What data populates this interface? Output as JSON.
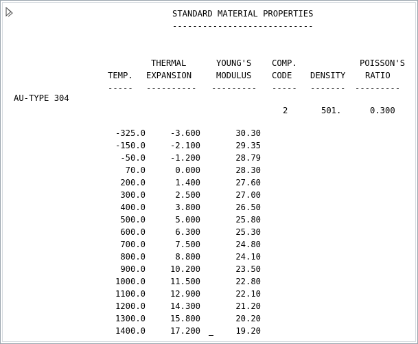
{
  "title": "STANDARD MATERIAL PROPERTIES",
  "title_underline": "----------------------------",
  "columns": {
    "temp": {
      "line1": "",
      "line2": "TEMP.",
      "dashes": "-----"
    },
    "thermal": {
      "line1": "THERMAL",
      "line2": "EXPANSION",
      "dashes": "----------"
    },
    "youngs": {
      "line1": "YOUNG'S",
      "line2": "MODULUS",
      "dashes": "---------"
    },
    "comp": {
      "line1": "COMP.",
      "line2": "CODE",
      "dashes": "-----"
    },
    "density": {
      "line1": "",
      "line2": "DENSITY",
      "dashes": "-------"
    },
    "poisson": {
      "line1": "POISSON'S",
      "line2": "RATIO",
      "dashes": "---------"
    }
  },
  "material": {
    "name": "AU-TYPE 304",
    "comp_code": "2",
    "density": "501.",
    "poisson_ratio": "0.300"
  },
  "rows": [
    {
      "temp": "-325.0",
      "thermal": "-3.600",
      "youngs": "30.30"
    },
    {
      "temp": "-150.0",
      "thermal": "-2.100",
      "youngs": "29.35"
    },
    {
      "temp": "-50.0",
      "thermal": "-1.200",
      "youngs": "28.79"
    },
    {
      "temp": "70.0",
      "thermal": "0.000",
      "youngs": "28.30"
    },
    {
      "temp": "200.0",
      "thermal": "1.400",
      "youngs": "27.60"
    },
    {
      "temp": "300.0",
      "thermal": "2.500",
      "youngs": "27.00"
    },
    {
      "temp": "400.0",
      "thermal": "3.800",
      "youngs": "26.50"
    },
    {
      "temp": "500.0",
      "thermal": "5.000",
      "youngs": "25.80"
    },
    {
      "temp": "600.0",
      "thermal": "6.300",
      "youngs": "25.30"
    },
    {
      "temp": "700.0",
      "thermal": "7.500",
      "youngs": "24.80"
    },
    {
      "temp": "800.0",
      "thermal": "8.800",
      "youngs": "24.10"
    },
    {
      "temp": "900.0",
      "thermal": "10.200",
      "youngs": "23.50"
    },
    {
      "temp": "1000.0",
      "thermal": "11.500",
      "youngs": "22.80"
    },
    {
      "temp": "1100.0",
      "thermal": "12.900",
      "youngs": "22.10"
    },
    {
      "temp": "1200.0",
      "thermal": "14.300",
      "youngs": "21.20"
    },
    {
      "temp": "1300.0",
      "thermal": "15.800",
      "youngs": "20.20"
    },
    {
      "temp": "1400.0",
      "thermal": "17.200",
      "youngs": "19.20"
    }
  ],
  "icons": {
    "corner": "expand-arrow-icon"
  }
}
